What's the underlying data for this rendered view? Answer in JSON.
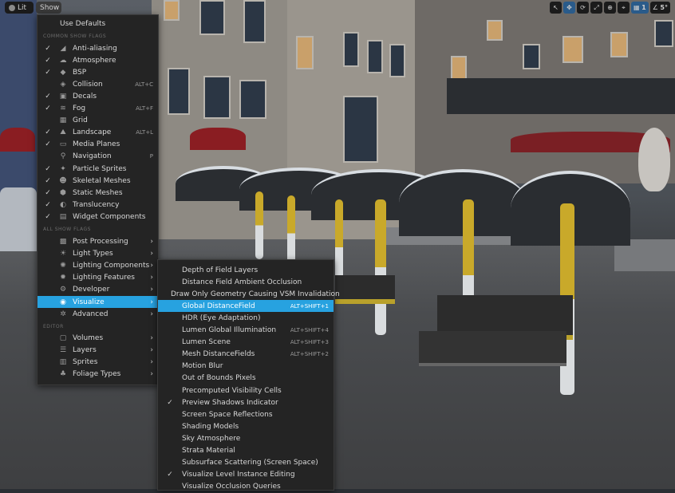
{
  "toolbar": {
    "lit_label": "Lit",
    "show_label": "Show",
    "grid_value": "1",
    "angle_value": "5°"
  },
  "show_menu": {
    "use_defaults": "Use Defaults",
    "common_header": "COMMON SHOW FLAGS",
    "common_items": [
      {
        "label": "Anti-aliasing",
        "checked": true,
        "icon": "anti-aliasing-icon",
        "shortcut": ""
      },
      {
        "label": "Atmosphere",
        "checked": true,
        "icon": "atmosphere-icon",
        "shortcut": ""
      },
      {
        "label": "BSP",
        "checked": true,
        "icon": "bsp-icon",
        "shortcut": ""
      },
      {
        "label": "Collision",
        "checked": false,
        "icon": "collision-icon",
        "shortcut": "ALT+C"
      },
      {
        "label": "Decals",
        "checked": true,
        "icon": "decals-icon",
        "shortcut": ""
      },
      {
        "label": "Fog",
        "checked": true,
        "icon": "fog-icon",
        "shortcut": "ALT+F"
      },
      {
        "label": "Grid",
        "checked": false,
        "icon": "grid-icon",
        "shortcut": ""
      },
      {
        "label": "Landscape",
        "checked": true,
        "icon": "landscape-icon",
        "shortcut": "ALT+L"
      },
      {
        "label": "Media Planes",
        "checked": true,
        "icon": "media-planes-icon",
        "shortcut": ""
      },
      {
        "label": "Navigation",
        "checked": false,
        "icon": "navigation-icon",
        "shortcut": "P"
      },
      {
        "label": "Particle Sprites",
        "checked": true,
        "icon": "particle-sprites-icon",
        "shortcut": ""
      },
      {
        "label": "Skeletal Meshes",
        "checked": true,
        "icon": "skeletal-meshes-icon",
        "shortcut": ""
      },
      {
        "label": "Static Meshes",
        "checked": true,
        "icon": "static-meshes-icon",
        "shortcut": ""
      },
      {
        "label": "Translucency",
        "checked": true,
        "icon": "translucency-icon",
        "shortcut": ""
      },
      {
        "label": "Widget Components",
        "checked": true,
        "icon": "widget-components-icon",
        "shortcut": ""
      }
    ],
    "all_header": "ALL SHOW FLAGS",
    "all_items": [
      {
        "label": "Post Processing",
        "icon": "post-processing-icon",
        "highlighted": false
      },
      {
        "label": "Light Types",
        "icon": "light-types-icon",
        "highlighted": false
      },
      {
        "label": "Lighting Components",
        "icon": "lighting-components-icon",
        "highlighted": false
      },
      {
        "label": "Lighting Features",
        "icon": "lighting-features-icon",
        "highlighted": false
      },
      {
        "label": "Developer",
        "icon": "developer-icon",
        "highlighted": false
      },
      {
        "label": "Visualize",
        "icon": "visualize-icon",
        "highlighted": true
      },
      {
        "label": "Advanced",
        "icon": "advanced-icon",
        "highlighted": false
      }
    ],
    "editor_header": "EDITOR",
    "editor_items": [
      {
        "label": "Volumes",
        "icon": "volumes-icon"
      },
      {
        "label": "Layers",
        "icon": "layers-icon"
      },
      {
        "label": "Sprites",
        "icon": "sprites-icon"
      },
      {
        "label": "Foliage Types",
        "icon": "foliage-types-icon"
      }
    ]
  },
  "visualize_menu": {
    "items": [
      {
        "label": "Depth of Field Layers",
        "shortcut": "",
        "checked": false,
        "highlighted": false
      },
      {
        "label": "Distance Field Ambient Occlusion",
        "shortcut": "",
        "checked": false,
        "highlighted": false
      },
      {
        "label": "Draw Only Geometry Causing VSM Invalidation",
        "shortcut": "",
        "checked": false,
        "highlighted": false
      },
      {
        "label": "Global DistanceField",
        "shortcut": "ALT+SHIFT+1",
        "checked": false,
        "highlighted": true
      },
      {
        "label": "HDR (Eye Adaptation)",
        "shortcut": "",
        "checked": false,
        "highlighted": false
      },
      {
        "label": "Lumen Global Illumination",
        "shortcut": "ALT+SHIFT+4",
        "checked": false,
        "highlighted": false
      },
      {
        "label": "Lumen Scene",
        "shortcut": "ALT+SHIFT+3",
        "checked": false,
        "highlighted": false
      },
      {
        "label": "Mesh DistanceFields",
        "shortcut": "ALT+SHIFT+2",
        "checked": false,
        "highlighted": false
      },
      {
        "label": "Motion Blur",
        "shortcut": "",
        "checked": false,
        "highlighted": false
      },
      {
        "label": "Out of Bounds Pixels",
        "shortcut": "",
        "checked": false,
        "highlighted": false
      },
      {
        "label": "Precomputed Visibility Cells",
        "shortcut": "",
        "checked": false,
        "highlighted": false
      },
      {
        "label": "Preview Shadows Indicator",
        "shortcut": "",
        "checked": true,
        "highlighted": false
      },
      {
        "label": "Screen Space Reflections",
        "shortcut": "",
        "checked": false,
        "highlighted": false
      },
      {
        "label": "Shading Models",
        "shortcut": "",
        "checked": false,
        "highlighted": false
      },
      {
        "label": "Sky Atmosphere",
        "shortcut": "",
        "checked": false,
        "highlighted": false
      },
      {
        "label": "Strata Material",
        "shortcut": "",
        "checked": false,
        "highlighted": false
      },
      {
        "label": "Subsurface Scattering (Screen Space)",
        "shortcut": "",
        "checked": false,
        "highlighted": false
      },
      {
        "label": "Visualize Level Instance Editing",
        "shortcut": "",
        "checked": true,
        "highlighted": false
      },
      {
        "label": "Visualize Occlusion Queries",
        "shortcut": "",
        "checked": false,
        "highlighted": false
      }
    ]
  },
  "colors": {
    "highlight": "#27a2e0",
    "menu_bg": "#242424"
  }
}
